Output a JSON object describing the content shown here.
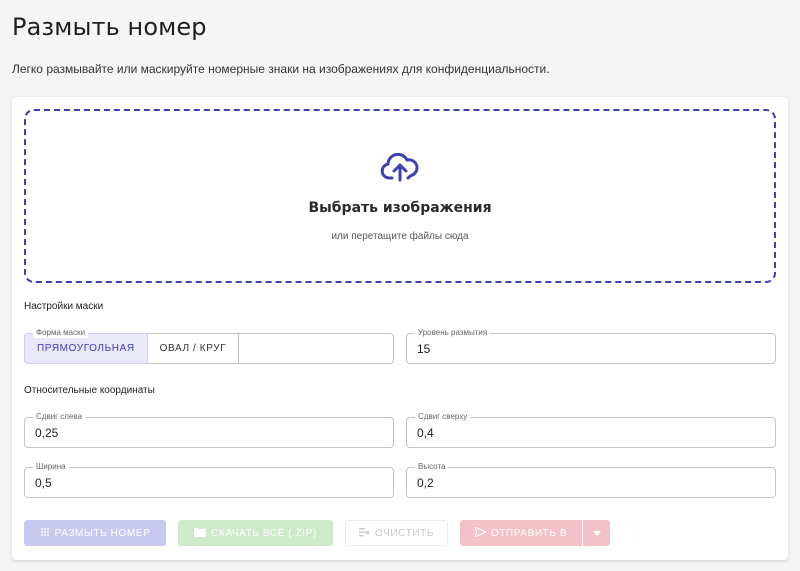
{
  "page": {
    "title": "Размыть номер",
    "subtitle": "Легко размывайте или маскируйте номерные знаки на изображениях для конфиденциальности."
  },
  "dropzone": {
    "icon": "cloud-upload-icon",
    "title": "Выбрать изображения",
    "hint": "или перетащите файлы сюда"
  },
  "mask_settings": {
    "label": "Настройки маски",
    "shape_label": "Форма маски",
    "shape_options": [
      "ПРЯМОУГОЛЬНАЯ",
      "ОВАЛ / КРУГ"
    ],
    "shape_selected": "ПРЯМОУГОЛЬНАЯ",
    "blur_label": "Уровень размытия",
    "blur_value": "15"
  },
  "coords": {
    "label": "Относительные координаты",
    "left_label": "Сдвиг слева",
    "left_value": "0,25",
    "top_label": "Сдвиг сверху",
    "top_value": "0,4",
    "width_label": "Ширина",
    "width_value": "0,5",
    "height_label": "Высота",
    "height_value": "0,2"
  },
  "actions": {
    "blur": "РАЗМЫТЬ НОМЕР",
    "download": "СКАЧАТЬ ВСЁ (.ZIP)",
    "clear": "ОЧИСТИТЬ",
    "send": "ОТПРАВИТЬ В"
  },
  "colors": {
    "accent": "#3f3fb0",
    "blur_btn": "#c9c9ef",
    "download_btn": "#cdeac9",
    "send_btn": "#f3c2c8"
  }
}
